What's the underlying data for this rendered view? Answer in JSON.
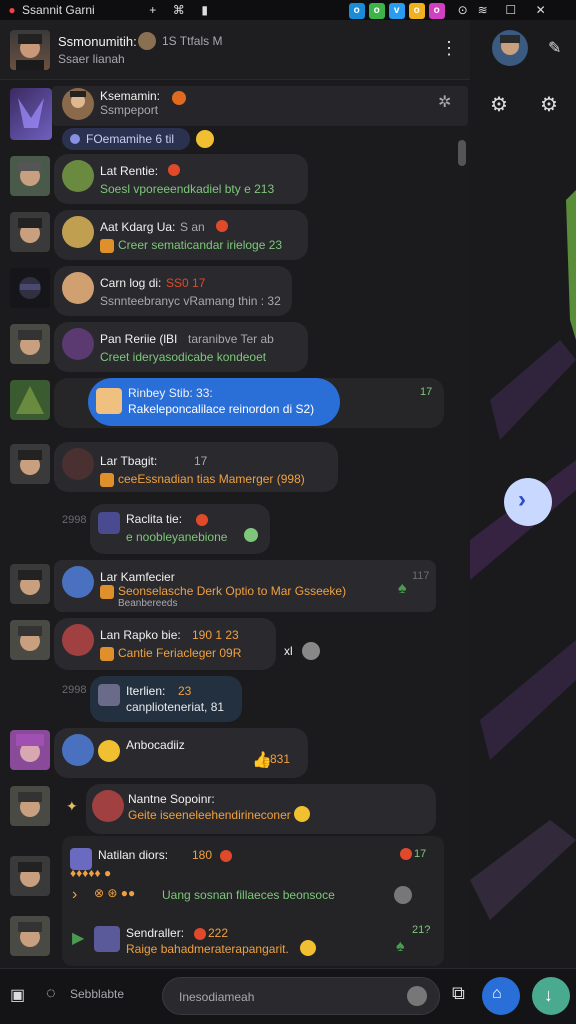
{
  "status": {
    "app_name": "Ssannit Garni"
  },
  "header": {
    "title": "Ssmonumitih:",
    "subtitle": "Ssaer lianah",
    "meta": "1S Ttfals M"
  },
  "pinned": {
    "name": "Ksemamin:",
    "sub": "Ssmpeport",
    "chip": "FOemamihe 6 til"
  },
  "messages": [
    {
      "name": "Lat Rentie:",
      "text": "Soesl vporeeendkadiel bty e 213"
    },
    {
      "name": "Aat Kdarg Ua:",
      "meta": "S an",
      "text": "Creer sematicandar irieloge 23"
    },
    {
      "name": "Carn log di:",
      "meta": "SS0 17",
      "text": "Ssnnteebranyc vRamang thin : 32"
    },
    {
      "name": "Pan Reriie (lBI",
      "meta": "taranibve Ter ab",
      "text": "Creet ideryasodicabe kondeoet"
    },
    {
      "name": "Rinbey Stib: 33:",
      "text": "Rakeleponcalilace reinordon di S2)",
      "time": "17"
    },
    {
      "name": "Lar Tbagit:",
      "meta": "17",
      "text": "ceeEssnadian tias Mamerger (998)"
    },
    {
      "name": "Raclita tie:",
      "text": "e noobleyanebione",
      "time": "2998"
    },
    {
      "name": "Lar Kamfecier",
      "text": "Seonselasche Derk Optio to Mar Gsseeke)",
      "sub": "Beanbereeds",
      "time": "117"
    },
    {
      "name": "Lan Rapko bie:",
      "meta": "190 1 23",
      "text": "Cantie Feriacleger 09R",
      "extra": "xl"
    },
    {
      "name": "Iterlien:",
      "meta": "23",
      "text": "canplioteneriat, 81",
      "time": "2998"
    },
    {
      "name": "Anbocadiiz",
      "meta": "831"
    },
    {
      "name": "Nantne Sopoinr:",
      "text": "Geite iseeneleehendirineconer"
    },
    {
      "name": "Natilan diors:",
      "meta": "180",
      "text": "Uang sosnan fillaeces beonsoce",
      "time": "17"
    },
    {
      "name": "Sendraller:",
      "meta": "222",
      "text": "Raige bahadmeraterapangarit.",
      "time": "21?"
    }
  ],
  "composer": {
    "placeholder": "Inesodiameah",
    "left_label": "Sebblabte"
  },
  "colors": {
    "accent": "#2a6fd8",
    "bg": "#1b1b1e",
    "bubble": "#2a2a2e",
    "green": "#7ec77a",
    "orange": "#f0a040"
  }
}
